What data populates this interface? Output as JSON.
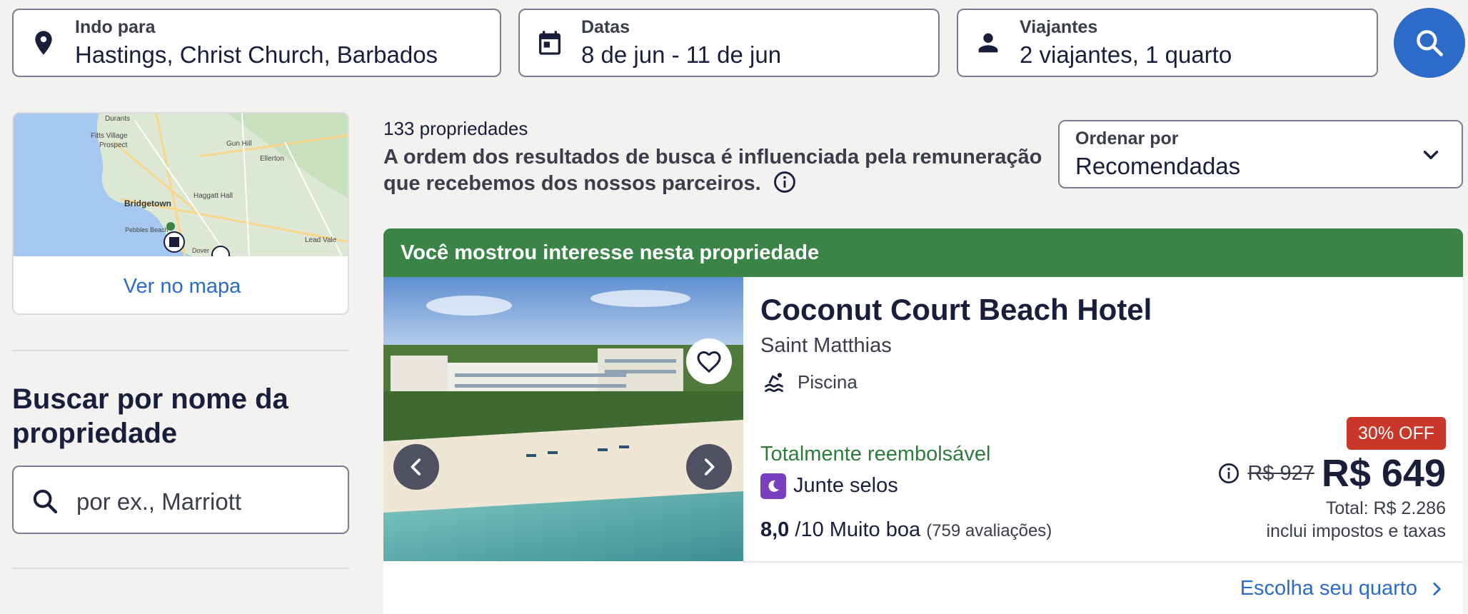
{
  "search": {
    "destination": {
      "label": "Indo para",
      "value": "Hastings, Christ Church, Barbados",
      "icon": "map-pin-icon"
    },
    "dates": {
      "label": "Datas",
      "value": "8 de jun - 11 de jun",
      "icon": "calendar-icon"
    },
    "travelers": {
      "label": "Viajantes",
      "value": "2 viajantes, 1 quarto",
      "icon": "person-icon"
    },
    "button_icon": "search-icon"
  },
  "sidebar": {
    "map": {
      "labels": [
        "Durants",
        "Fitts Village",
        "Prospect",
        "Gun Hill",
        "Ellerton",
        "Bridgetown",
        "Haggatt Hall",
        "Pebbles Beach",
        "Dover",
        "Lead Vale"
      ],
      "link_text": "Ver no mapa"
    },
    "name_search": {
      "title": "Buscar por nome da propriedade",
      "placeholder": "por ex., Marriott"
    }
  },
  "results": {
    "count": "133 propriedades",
    "disclaimer": "A ordem dos resultados de busca é influenciada pela remuneração que recebemos dos nossos parceiros.",
    "sort": {
      "label": "Ordenar por",
      "value": "Recomendadas"
    }
  },
  "property": {
    "banner": "Você mostrou interesse nesta propriedade",
    "name": "Coconut Court Beach Hotel",
    "area": "Saint Matthias",
    "amenity": "Piscina",
    "refund": "Totalmente reembolsável",
    "stamps": "Junte selos",
    "rating_score": "8,0",
    "rating_scale": "/10 Muito boa",
    "rating_reviews": "(759 avaliações)",
    "discount": "30% OFF",
    "old_price": "R$ 927",
    "price": "R$ 649",
    "total": "Total: R$ 2.286",
    "taxes": "inclui impostos e taxas",
    "cta": "Escolha seu quarto"
  },
  "colors": {
    "accent": "#2c6cc8",
    "banner": "#3b8447",
    "discount": "#c8382b",
    "refund": "#2f7b3c",
    "stamp": "#7a3fc0"
  }
}
